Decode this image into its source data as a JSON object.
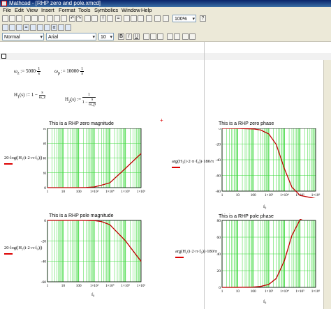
{
  "window": {
    "title": "Mathcad - [RHP zero and pole.xmcd]"
  },
  "menu": [
    "File",
    "Edit",
    "View",
    "Insert",
    "Format",
    "Tools",
    "Symbolics",
    "Window",
    "Help"
  ],
  "toolbar": {
    "zoom": "100%",
    "style": "Normal",
    "font": "Arial",
    "size": "10",
    "bold": "B",
    "italic": "I",
    "underline": "U"
  },
  "definitions": {
    "omega_z": {
      "lhs": "ω",
      "sub": "z",
      "assign": ":=",
      "value": "5000·",
      "unit_n": "1",
      "unit_d": "s"
    },
    "omega_p": {
      "lhs": "ω",
      "sub": "p",
      "assign": ":=",
      "value": "10000·",
      "unit_n": "1",
      "unit_d": "s"
    },
    "H1": {
      "lhs": "H",
      "sub": "1",
      "args": "(s) := 1 −",
      "num": "s",
      "den": "ω_z"
    },
    "H2": {
      "lhs": "H",
      "sub": "2",
      "args": "(s) :=",
      "num": "1",
      "den_a": "1 −",
      "den_num": "s",
      "den_den": "ω_p"
    }
  },
  "plots": [
    {
      "title": "This is a RHP zero magnitude",
      "ylabel": "20·log(|H₁(i·2·π·f₀)|)",
      "xlabel": "f₀",
      "chart_data": {
        "type": "line",
        "xscale": "log",
        "xlim": [
          1,
          1000000
        ],
        "ylim": [
          0,
          80
        ],
        "yticks": [
          "0",
          "20",
          "40",
          "60",
          "80"
        ],
        "xticks": [
          "1",
          "10",
          "100",
          "1×10³",
          "1×10⁴",
          "1×10⁵",
          "1×10⁶"
        ],
        "series": [
          {
            "x": [
              1,
              10,
              100,
              300,
              1000,
              3000,
              10000,
              100000,
              1000000
            ],
            "y": [
              0,
              0,
              0,
              0.2,
              0.9,
              3.4,
              6.5,
              26,
              46
            ]
          }
        ]
      }
    },
    {
      "title": "This is a RHP zero phase",
      "ylabel": "arg(H₁(i·2·π·f₀))·180/π",
      "xlabel": "f₀",
      "chart_data": {
        "type": "line",
        "xscale": "log",
        "xlim": [
          1,
          1000000
        ],
        "ylim": [
          -80,
          0
        ],
        "yticks": [
          "0",
          "-20",
          "-40",
          "-60",
          "-80"
        ],
        "xticks": [
          "1",
          "10",
          "100",
          "1×10³",
          "1×10⁴",
          "1×10⁵",
          "1×10⁶"
        ],
        "series": [
          {
            "x": [
              1,
              10,
              100,
              300,
              1000,
              3000,
              10000,
              30000,
              100000,
              1000000
            ],
            "y": [
              -0.01,
              -0.07,
              -0.7,
              -2.1,
              -7.2,
              -20.7,
              -51.5,
              -75,
              -85.5,
              -89.5
            ]
          }
        ]
      }
    },
    {
      "title": "This is a RHP pole magnitude",
      "ylabel": "20·log(|H₂(i·2·π·f₀)|)",
      "xlabel": "f₀",
      "chart_data": {
        "type": "line",
        "xscale": "log",
        "xlim": [
          1,
          1000000
        ],
        "ylim": [
          -60,
          0
        ],
        "yticks": [
          "0",
          "-20",
          "-40",
          "-60"
        ],
        "xticks": [
          "1",
          "10",
          "100",
          "1×10³",
          "1×10⁴",
          "1×10⁵",
          "1×10⁶"
        ],
        "series": [
          {
            "x": [
              1,
              10,
              100,
              300,
              1000,
              3000,
              10000,
              100000,
              1000000
            ],
            "y": [
              0,
              0,
              0,
              -0.1,
              -0.2,
              -1.2,
              -4.2,
              -20,
              -40
            ]
          }
        ]
      }
    },
    {
      "title": "This is a RHP pole phase",
      "ylabel": "arg(H₂(i·2·π·f₀))·180/π",
      "xlabel": "f₀",
      "chart_data": {
        "type": "line",
        "xscale": "log",
        "xlim": [
          1,
          1000000
        ],
        "ylim": [
          0,
          80
        ],
        "yticks": [
          "0",
          "20",
          "40",
          "60",
          "80"
        ],
        "xticks": [
          "1",
          "10",
          "100",
          "1×10³",
          "1×10⁴",
          "1×10⁵",
          "1×10⁶"
        ],
        "series": [
          {
            "x": [
              1,
              10,
              100,
              300,
              1000,
              3000,
              10000,
              30000,
              100000,
              1000000
            ],
            "y": [
              0.01,
              0.04,
              0.36,
              1.1,
              3.6,
              10.7,
              32.1,
              62,
              81,
              88.5
            ]
          }
        ]
      }
    }
  ]
}
